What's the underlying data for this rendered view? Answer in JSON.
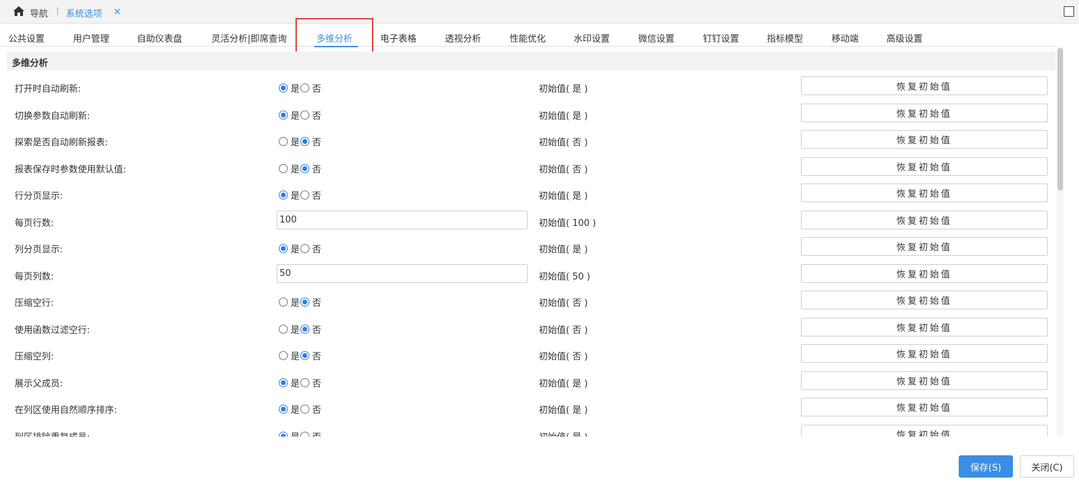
{
  "header": {
    "home_icon": "home-icon",
    "nav_label": "导航",
    "separator": "|",
    "tab_label": "系统选项",
    "tab_close": "×",
    "maximize_icon": "maximize-icon"
  },
  "tabs": [
    {
      "label": "公共设置"
    },
    {
      "label": "用户管理"
    },
    {
      "label": "自助仪表盘"
    },
    {
      "label": "灵活分析|即席查询"
    },
    {
      "label": "多维分析",
      "active": true
    },
    {
      "label": "电子表格"
    },
    {
      "label": "透视分析"
    },
    {
      "label": "性能优化"
    },
    {
      "label": "水印设置"
    },
    {
      "label": "微信设置"
    },
    {
      "label": "钉钉设置"
    },
    {
      "label": "指标模型"
    },
    {
      "label": "移动端"
    },
    {
      "label": "高级设置"
    }
  ],
  "section": {
    "title": "多维分析"
  },
  "labels": {
    "yes": "是",
    "no": "否",
    "reset": "恢复初始值"
  },
  "settings": [
    {
      "label": "打开时自动刷新:",
      "type": "radio",
      "value": "是",
      "initial": "初始值( 是 )"
    },
    {
      "label": "切换参数自动刷新:",
      "type": "radio",
      "value": "是",
      "initial": "初始值( 是 )"
    },
    {
      "label": "探索是否自动刷新报表:",
      "type": "radio",
      "value": "否",
      "initial": "初始值( 否 )"
    },
    {
      "label": "报表保存时参数使用默认值:",
      "type": "radio",
      "value": "否",
      "initial": "初始值( 否 )"
    },
    {
      "label": "行分页显示:",
      "type": "radio",
      "value": "是",
      "initial": "初始值( 是 )"
    },
    {
      "label": "每页行数:",
      "type": "text",
      "value": "100",
      "initial": "初始值( 100 )"
    },
    {
      "label": "列分页显示:",
      "type": "radio",
      "value": "是",
      "initial": "初始值( 是 )"
    },
    {
      "label": "每页列数:",
      "type": "text",
      "value": "50",
      "initial": "初始值( 50 )"
    },
    {
      "label": "压缩空行:",
      "type": "radio",
      "value": "否",
      "initial": "初始值( 否 )"
    },
    {
      "label": "使用函数过滤空行:",
      "type": "radio",
      "value": "否",
      "initial": "初始值( 否 )"
    },
    {
      "label": "压缩空列:",
      "type": "radio",
      "value": "否",
      "initial": "初始值( 否 )"
    },
    {
      "label": "展示父成员:",
      "type": "radio",
      "value": "是",
      "initial": "初始值( 是 )"
    },
    {
      "label": "在列区使用自然顺序排序:",
      "type": "radio",
      "value": "是",
      "initial": "初始值( 是 )"
    },
    {
      "label": "列区排除重复成员:",
      "type": "radio",
      "value": "是",
      "initial": "初始值( 是 )"
    }
  ],
  "footer": {
    "save_label": "保存(S)",
    "close_label": "关闭(C)"
  },
  "colors": {
    "accent": "#3a8ee6",
    "highlight": "#e0443c"
  }
}
